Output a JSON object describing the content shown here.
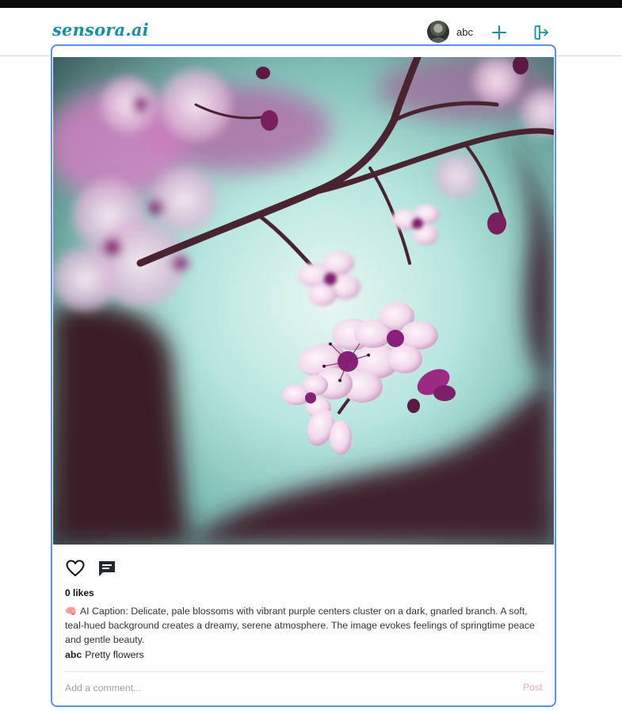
{
  "app": {
    "logo": "sensora.ai"
  },
  "header": {
    "username": "abc",
    "avatar_icon": "user-avatar",
    "create_icon": "plus-icon",
    "logout_icon": "logout-icon",
    "accent_color": "#1a8ea3"
  },
  "post": {
    "image_description_icon": "cherry-blossom-photo",
    "like_icon": "heart-outline-icon",
    "comment_icon": "chat-bubble-icon",
    "likes_text": "0 likes",
    "ai_caption_icon": "brain-icon",
    "ai_caption": "AI Caption: Delicate, pale blossoms with vibrant purple centers cluster on a dark, gnarled branch. A soft, teal-hued background creates a dreamy, serene atmosphere. The image evokes feelings of springtime peace and gentle beauty.",
    "author": "abc",
    "text": "Pretty flowers",
    "comment_placeholder": "Add a comment...",
    "post_label": "Post",
    "border_color": "#5b8ef0"
  }
}
